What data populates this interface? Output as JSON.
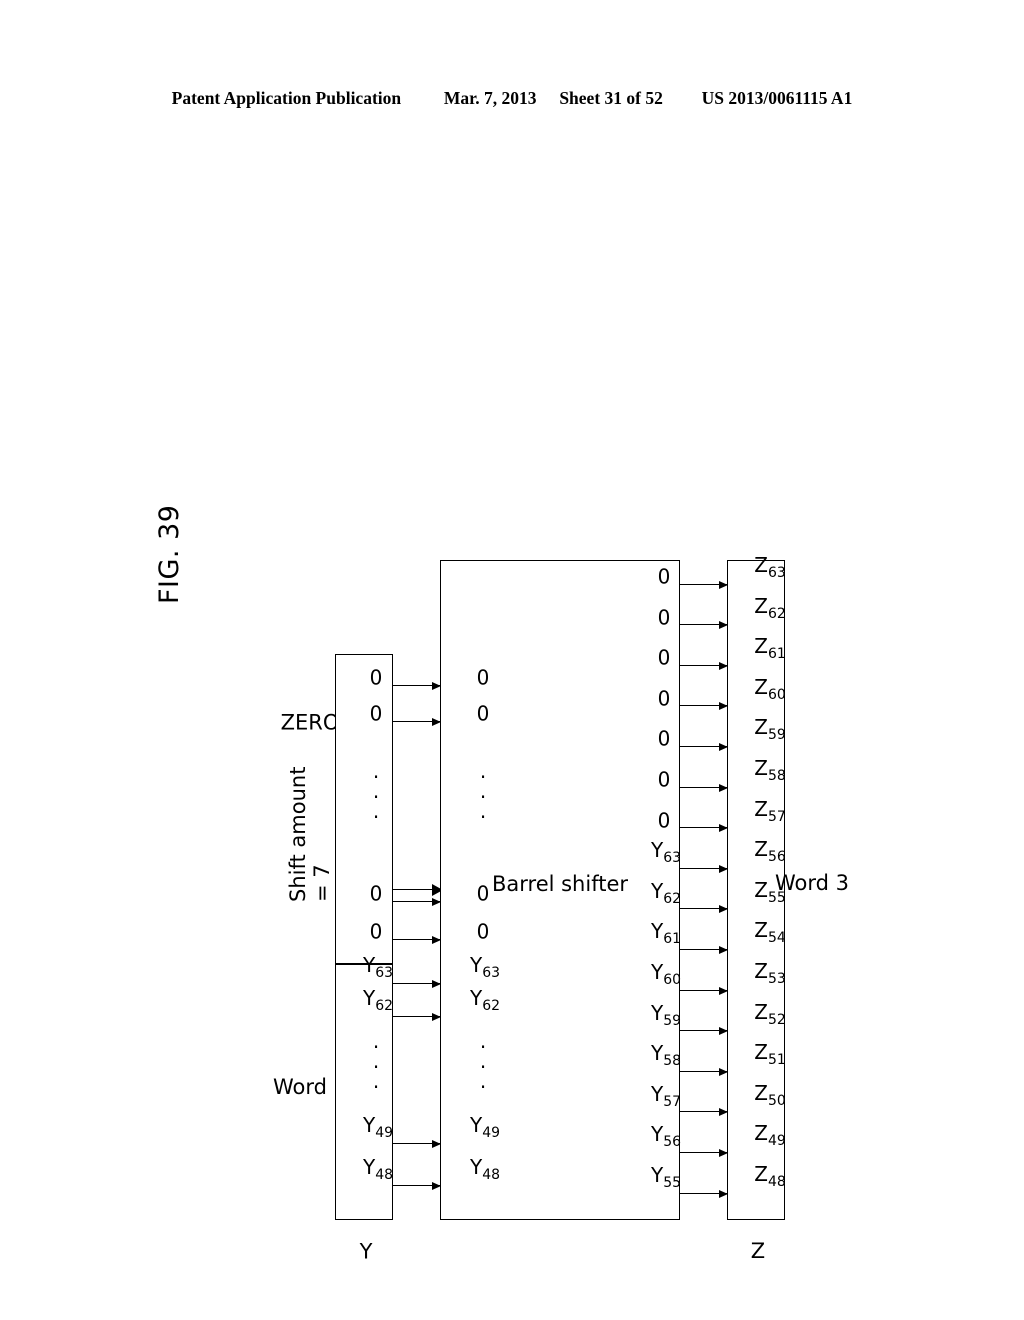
{
  "header": {
    "publication": "Patent Application Publication",
    "date": "Mar. 7, 2013",
    "sheet": "Sheet 31 of 52",
    "patent_number": "US 2013/0061115 A1"
  },
  "figure": {
    "label": "FIG. 39",
    "shift_annotation_line1": "Shift amount",
    "shift_annotation_line2": "= 7",
    "barrel_shifter_label": "Barrel shifter",
    "input_bus_label": "Y",
    "output_bus_label": "Z",
    "word_label_input": "Word 3",
    "zero_label_input": "ZERO",
    "word_label_output": "Word 3",
    "ellipsis": "· · ·"
  },
  "chart_data": {
    "type": "diagram",
    "title": "FIG. 39 — Barrel shifter data path, shift amount = 7",
    "shift_amount": 7,
    "input_register_Y": {
      "word_section": [
        "Y48",
        "Y49",
        "...",
        "Y62",
        "Y63"
      ],
      "zero_section": [
        "0",
        "0",
        "...",
        "0",
        "0"
      ]
    },
    "shifter_input": [
      "Y48",
      "Y49",
      "...",
      "Y62",
      "Y63",
      "0",
      "0",
      "...",
      "0",
      "0"
    ],
    "shifter_output": [
      "Y55",
      "Y56",
      "Y57",
      "Y58",
      "Y59",
      "Y60",
      "Y61",
      "Y62",
      "Y63",
      "0",
      "0",
      "0",
      "0",
      "0",
      "0",
      "0"
    ],
    "output_register_Z": [
      "Z48",
      "Z49",
      "Z50",
      "Z51",
      "Z52",
      "Z53",
      "Z54",
      "Z55",
      "Z56",
      "Z57",
      "Z58",
      "Z59",
      "Z60",
      "Z61",
      "Z62",
      "Z63"
    ],
    "input_arrow_count": 8,
    "output_arrow_count": 16
  }
}
